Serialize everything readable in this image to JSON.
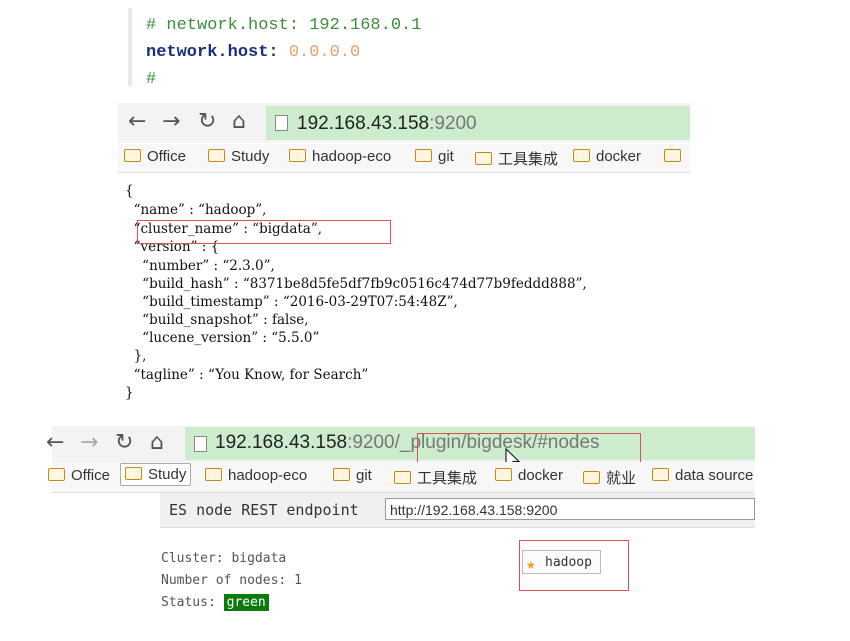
{
  "code_snippet": {
    "comment_line": "# network.host: 192.168.0.1",
    "key": "network.host",
    "colon": ":",
    "value": "0.0.0.0",
    "trailing": "#"
  },
  "browser1": {
    "url_host": "192.168.43.158",
    "url_rest": ":9200",
    "bookmarks": [
      "Office",
      "Study",
      "hadoop-eco",
      "git",
      "工具集成",
      "docker"
    ]
  },
  "json_response": [
    "{",
    "  “name” : “hadoop”,",
    "  “cluster_name” : “bigdata”,",
    "  “version” : {",
    "    “number” : “2.3.0”,",
    "    “build_hash” : “8371be8d5fe5df7fb9c0516c474d77b9feddd888”,",
    "    “build_timestamp” : “2016-03-29T07:54:48Z”,",
    "    “build_snapshot” : false,",
    "    “lucene_version” : “5.5.0”",
    "  },",
    "  “tagline” : “You Know, for Search”",
    "}"
  ],
  "browser2": {
    "url_host": "192.168.43.158",
    "url_rest": ":9200/_plugin/bigdesk/#nodes",
    "bookmarks": [
      "Office",
      "Study",
      "hadoop-eco",
      "git",
      "工具集成",
      "docker",
      "就业",
      "data source"
    ]
  },
  "bigdesk": {
    "endpoint_label": "ES node REST endpoint",
    "endpoint_value": "http://192.168.43.158:9200",
    "cluster_label": "Cluster:",
    "cluster_value": "bigdata",
    "nodes_label": "Number of nodes:",
    "nodes_value": "1",
    "status_label": "Status:",
    "status_value": "green",
    "node_name": "hadoop"
  },
  "colors": {
    "address_bar_bg": "#cdeccd",
    "highlight_box": "#e05050",
    "status_green": "#0c7a0c"
  }
}
